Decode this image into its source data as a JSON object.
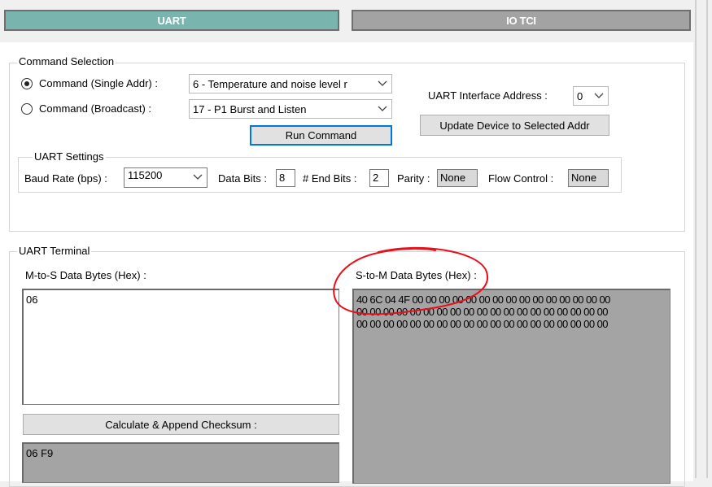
{
  "tabs": [
    {
      "label": "UART",
      "active": true
    },
    {
      "label": "IO TCI",
      "active": false
    }
  ],
  "command_selection": {
    "legend": "Command Selection",
    "single_label": "Command (Single Addr) :",
    "single_value": "6 - Temperature and noise level r",
    "broadcast_label": "Command (Broadcast) :",
    "broadcast_value": "17 - P1 Burst and Listen",
    "run_button": "Run Command",
    "interface_addr_label": "UART Interface Address :",
    "interface_addr_value": "0",
    "update_button": "Update Device to Selected Addr"
  },
  "uart_settings": {
    "legend": "UART Settings",
    "baud_label": "Baud Rate (bps) :",
    "baud_value": "115200",
    "data_bits_label": "Data Bits :",
    "data_bits_value": "8",
    "end_bits_label": "# End Bits :",
    "end_bits_value": "2",
    "parity_label": "Parity :",
    "parity_value": "None",
    "flow_label": "Flow Control :",
    "flow_value": "None"
  },
  "terminal": {
    "legend": "UART Terminal",
    "m2s_label": "M-to-S Data Bytes (Hex) :",
    "m2s_value": "06",
    "s2m_label": "S-to-M Data Bytes (Hex) :",
    "s2m_lines": [
      "40 6C 04 4F 00 00 00 00 00 00 00 00 00 00 00 00 00 00 00",
      "00 00 00 00 00 00 00 00 00 00 00 00 00 00 00 00 00 00 00",
      "00 00 00 00 00 00 00 00 00 00 00 00 00 00 00 00 00 00 00"
    ],
    "checksum_button": "Calculate & Append Checksum :",
    "checksum_value": "06 F9"
  },
  "colors": {
    "active_tab": "#79b4ae",
    "inactive_tab": "#a3a3a3",
    "annotation": "#e8101a",
    "focus_border": "#0078d7"
  }
}
